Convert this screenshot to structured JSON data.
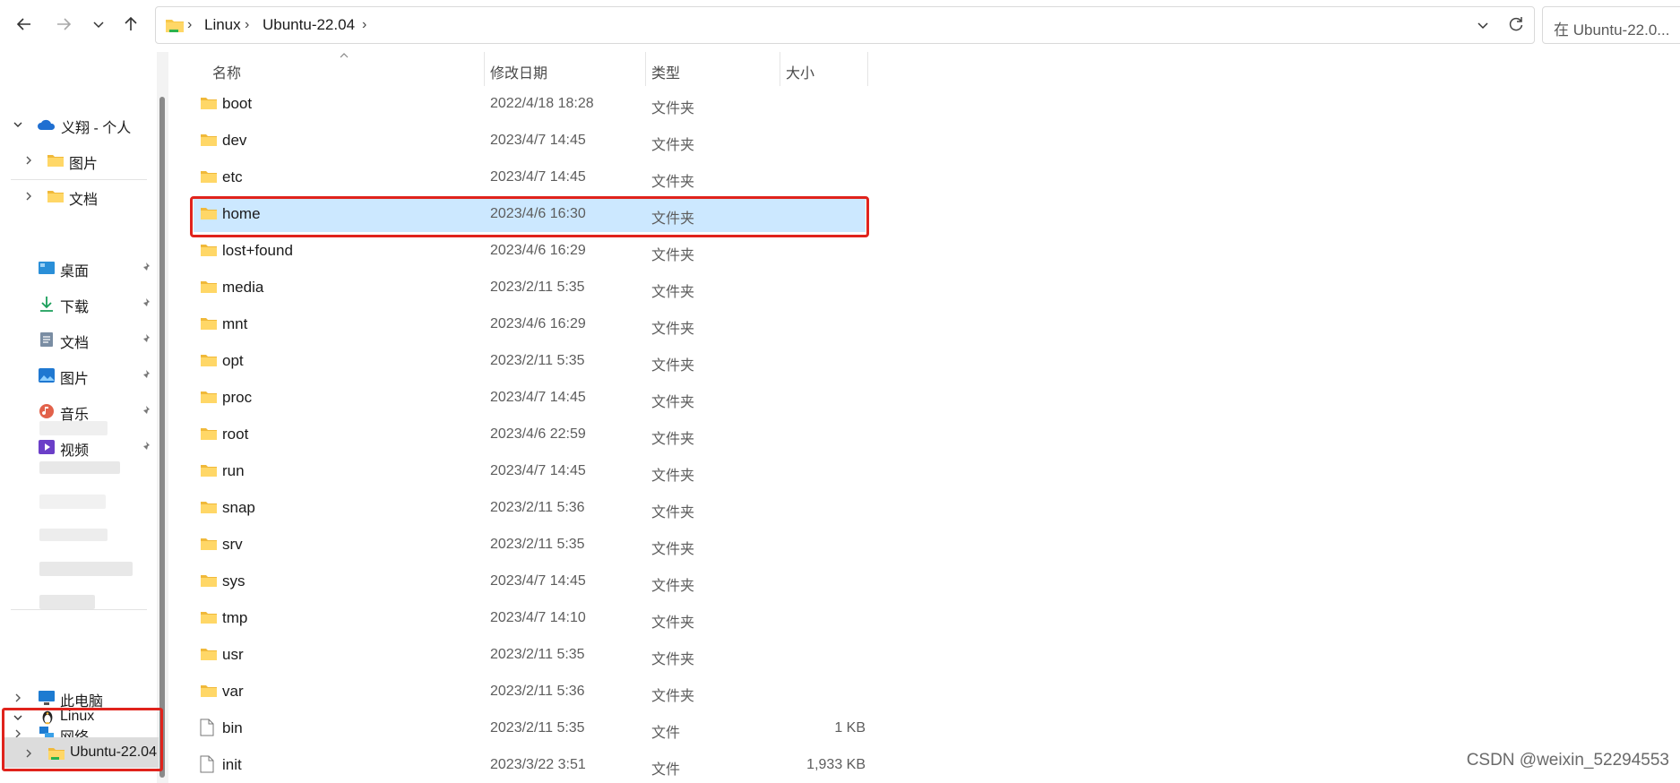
{
  "toolbar": {
    "back_icon": "arrow-left-icon",
    "forward_icon": "arrow-right-icon",
    "recent_icon": "chevron-down-icon",
    "up_icon": "arrow-up-icon"
  },
  "address": {
    "crumbs": [
      "Linux",
      "Ubuntu-22.04"
    ],
    "separator": "›"
  },
  "search": {
    "placeholder": "在 Ubuntu-22.0..."
  },
  "sidebar": {
    "onedrive": {
      "label": "义翔 - 个人",
      "children": [
        "图片",
        "文档"
      ]
    },
    "quick_access": [
      {
        "label": "桌面",
        "icon": "desktop-icon"
      },
      {
        "label": "下载",
        "icon": "download-icon"
      },
      {
        "label": "文档",
        "icon": "document-icon"
      },
      {
        "label": "图片",
        "icon": "picture-icon"
      },
      {
        "label": "音乐",
        "icon": "music-icon"
      },
      {
        "label": "视频",
        "icon": "video-icon"
      }
    ],
    "this_pc": "此电脑",
    "network": "网络",
    "linux": "Linux",
    "ubuntu": "Ubuntu-22.04"
  },
  "columns": {
    "name": "名称",
    "date": "修改日期",
    "type": "类型",
    "size": "大小"
  },
  "files": [
    {
      "name": "boot",
      "date": "2022/4/18 18:28",
      "type": "文件夹",
      "size": "",
      "kind": "folder"
    },
    {
      "name": "dev",
      "date": "2023/4/7 14:45",
      "type": "文件夹",
      "size": "",
      "kind": "folder"
    },
    {
      "name": "etc",
      "date": "2023/4/7 14:45",
      "type": "文件夹",
      "size": "",
      "kind": "folder"
    },
    {
      "name": "home",
      "date": "2023/4/6 16:30",
      "type": "文件夹",
      "size": "",
      "kind": "folder",
      "selected": true
    },
    {
      "name": "lost+found",
      "date": "2023/4/6 16:29",
      "type": "文件夹",
      "size": "",
      "kind": "folder"
    },
    {
      "name": "media",
      "date": "2023/2/11 5:35",
      "type": "文件夹",
      "size": "",
      "kind": "folder"
    },
    {
      "name": "mnt",
      "date": "2023/4/6 16:29",
      "type": "文件夹",
      "size": "",
      "kind": "folder"
    },
    {
      "name": "opt",
      "date": "2023/2/11 5:35",
      "type": "文件夹",
      "size": "",
      "kind": "folder"
    },
    {
      "name": "proc",
      "date": "2023/4/7 14:45",
      "type": "文件夹",
      "size": "",
      "kind": "folder"
    },
    {
      "name": "root",
      "date": "2023/4/6 22:59",
      "type": "文件夹",
      "size": "",
      "kind": "folder"
    },
    {
      "name": "run",
      "date": "2023/4/7 14:45",
      "type": "文件夹",
      "size": "",
      "kind": "folder"
    },
    {
      "name": "snap",
      "date": "2023/2/11 5:36",
      "type": "文件夹",
      "size": "",
      "kind": "folder"
    },
    {
      "name": "srv",
      "date": "2023/2/11 5:35",
      "type": "文件夹",
      "size": "",
      "kind": "folder"
    },
    {
      "name": "sys",
      "date": "2023/4/7 14:45",
      "type": "文件夹",
      "size": "",
      "kind": "folder"
    },
    {
      "name": "tmp",
      "date": "2023/4/7 14:10",
      "type": "文件夹",
      "size": "",
      "kind": "folder"
    },
    {
      "name": "usr",
      "date": "2023/2/11 5:35",
      "type": "文件夹",
      "size": "",
      "kind": "folder"
    },
    {
      "name": "var",
      "date": "2023/2/11 5:36",
      "type": "文件夹",
      "size": "",
      "kind": "folder"
    },
    {
      "name": "bin",
      "date": "2023/2/11 5:35",
      "type": "文件",
      "size": "1 KB",
      "kind": "file"
    },
    {
      "name": "init",
      "date": "2023/3/22 3:51",
      "type": "文件",
      "size": "1,933 KB",
      "kind": "file"
    }
  ],
  "colors": {
    "selection": "#cce8ff",
    "highlight": "#e0231c",
    "folder": "#f8c84a"
  },
  "watermark": "CSDN @weixin_52294553"
}
